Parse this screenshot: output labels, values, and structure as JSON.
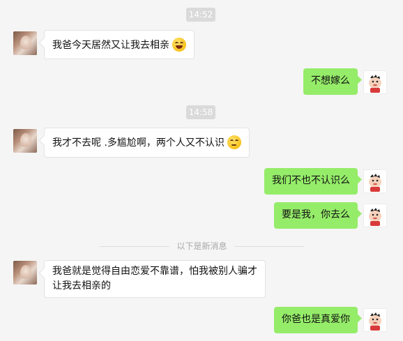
{
  "timestamps": [
    "14:52",
    "14:58"
  ],
  "divider_label": "以下是新消息",
  "messages": [
    {
      "side": "left",
      "text": "我爸今天居然又让我去相亲",
      "emoji": "grinning-squint-emoji"
    },
    {
      "side": "right",
      "text": "不想嫁么"
    },
    {
      "side": "left",
      "text": "我才不去呢 .多尴尬啊，两个人又不认识",
      "emoji": "confused-emoji"
    },
    {
      "side": "right",
      "text": "我们不也不认识么"
    },
    {
      "side": "right",
      "text": "要是我，你去么"
    },
    {
      "side": "left",
      "line1": "我爸就是觉得自由恋爱不靠谱，怕我被别人骗才",
      "line2": "让我去相亲的"
    },
    {
      "side": "right",
      "text": "你爸也是真爱你"
    }
  ],
  "colors": {
    "background": "#f5f5f5",
    "incoming_bubble": "#ffffff",
    "outgoing_bubble": "#95ec69",
    "timestamp_bg": "#dadada"
  },
  "avatars": {
    "contact": "contact-avatar",
    "self": "cartoon-boy-avatar"
  }
}
